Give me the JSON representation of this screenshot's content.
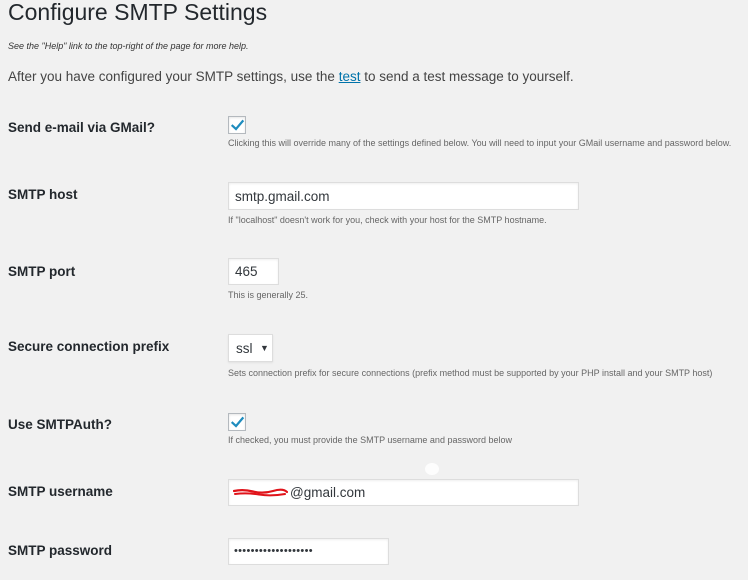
{
  "page": {
    "title": "Configure SMTP Settings",
    "help_note": "See the \"Help\" link to the top-right of the page for more help.",
    "intro_before": "After you have configured your SMTP settings, use the ",
    "intro_link": "test",
    "intro_after": " to send a test message to yourself."
  },
  "fields": {
    "gmail": {
      "label": "Send e-mail via GMail?",
      "checked": true,
      "description": "Clicking this will override many of the settings defined below. You will need to input your GMail username and password below."
    },
    "host": {
      "label": "SMTP host",
      "value": "smtp.gmail.com",
      "description": "If \"localhost\" doesn't work for you, check with your host for the SMTP hostname."
    },
    "port": {
      "label": "SMTP port",
      "value": "465",
      "description": "This is generally 25."
    },
    "prefix": {
      "label": "Secure connection prefix",
      "selected": "ssl",
      "arrow": "▼",
      "description": "Sets connection prefix for secure connections (prefix method must be supported by your PHP install and your SMTP host)"
    },
    "auth": {
      "label": "Use SMTPAuth?",
      "checked": true,
      "description": "If checked, you must provide the SMTP username and password below"
    },
    "username": {
      "label": "SMTP username",
      "visible_value": "@gmail.com"
    },
    "password": {
      "label": "SMTP password",
      "masked_value": "•••••••••••••••••••"
    }
  },
  "colors": {
    "background": "#f1f1f1",
    "link": "#0073aa",
    "checkmark": "#1e8cbe",
    "redaction": "#e0131a"
  },
  "icons": {
    "checkbox_mark": "checkmark-icon",
    "select_arrow": "triangle-down-icon"
  }
}
